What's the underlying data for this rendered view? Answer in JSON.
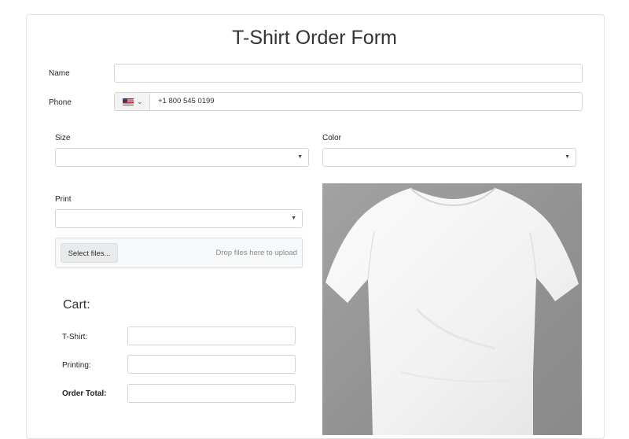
{
  "form": {
    "title": "T-Shirt Order Form",
    "name_label": "Name",
    "name_value": "",
    "phone_label": "Phone",
    "phone_country": "us-flag-icon",
    "phone_value": "+1 800 545 0199",
    "size_label": "Size",
    "size_value": "",
    "color_label": "Color",
    "color_value": "",
    "print_label": "Print",
    "print_value": "",
    "upload": {
      "button_label": "Select files...",
      "hint": "Drop files here to upload"
    },
    "preview_image": "white-tshirt-image"
  },
  "cart": {
    "title": "Cart:",
    "tshirt_label": "T-Shirt:",
    "tshirt_value": "",
    "printing_label": "Printing:",
    "printing_value": "",
    "total_label": "Order Total:",
    "total_value": ""
  }
}
